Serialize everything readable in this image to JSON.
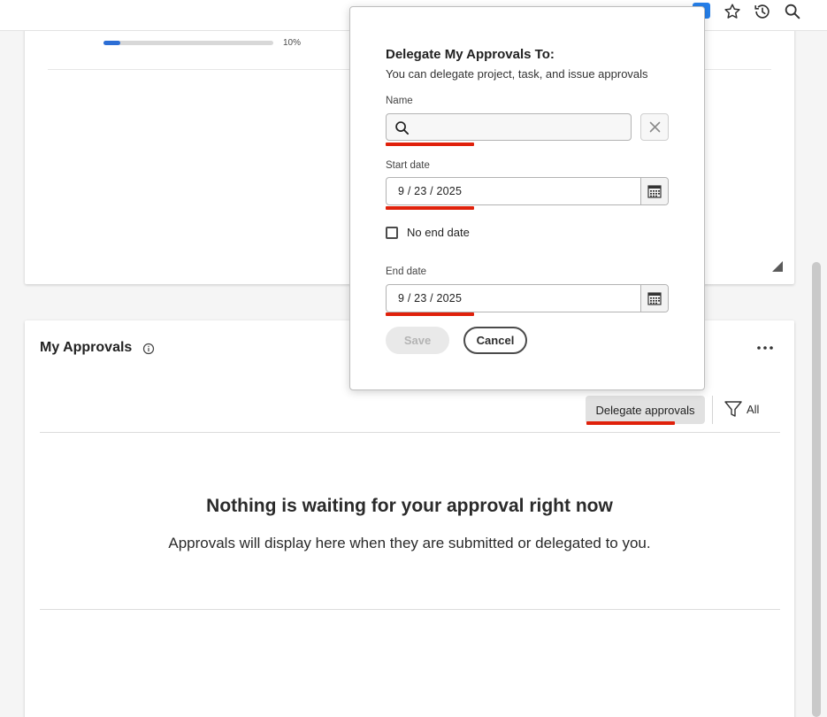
{
  "toolbar": {
    "icons": [
      "extension-icon",
      "star-icon",
      "history-icon",
      "search-icon"
    ]
  },
  "top_card": {
    "progress_fraction": 0.1,
    "progress_label": "10%"
  },
  "approvals": {
    "title": "My Approvals",
    "delegate_button": "Delegate approvals",
    "filter_label": "All",
    "empty_title": "Nothing is waiting for your approval right now",
    "empty_subtitle": "Approvals will display here when they are submitted or delegated to you."
  },
  "dialog": {
    "title": "Delegate My Approvals To:",
    "subtitle": "You can delegate project, task, and issue approvals",
    "name_label": "Name",
    "name_value": "",
    "start_date_label": "Start date",
    "start_date": "9 / 23 / 2025",
    "no_end_date_label": "No end date",
    "no_end_date_checked": false,
    "end_date_label": "End date",
    "end_date": "9 / 23 / 2025",
    "save_label": "Save",
    "cancel_label": "Cancel"
  },
  "colors": {
    "accent": "#2c6ed5",
    "annotation": "#e0210b"
  }
}
